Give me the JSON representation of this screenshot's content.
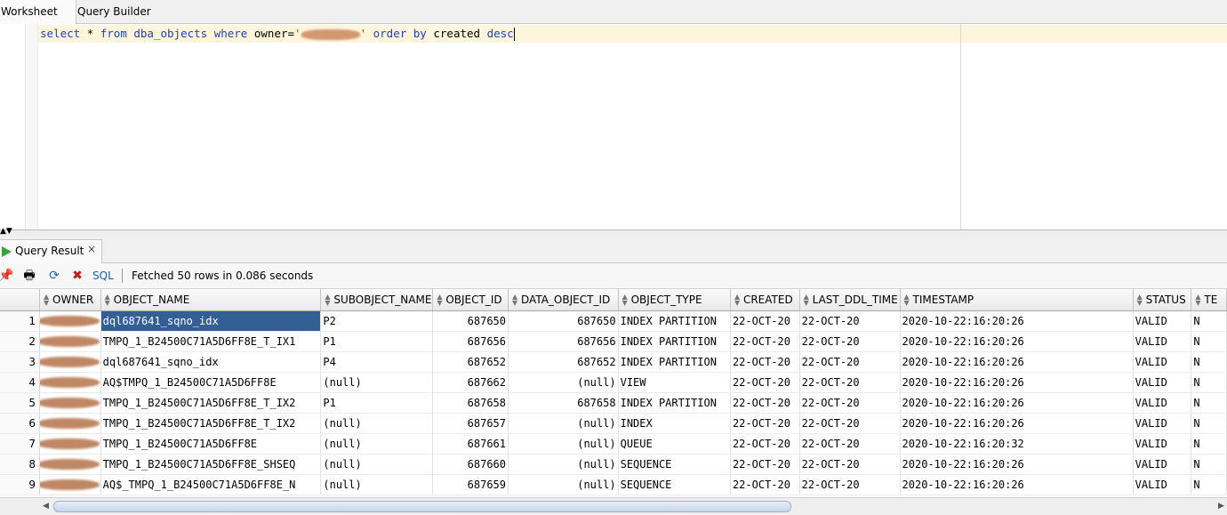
{
  "tabs": [
    {
      "label": "Worksheet"
    },
    {
      "label": "Query Builder"
    }
  ],
  "editor": {
    "tokens": [
      "select",
      "*",
      "from dba_objects",
      "where",
      "owner=",
      "'",
      "'",
      "order by",
      "created",
      "desc"
    ]
  },
  "result_tab": {
    "label": "Query Result",
    "close": "×"
  },
  "toolbar": {
    "sql_label": "SQL",
    "status": "Fetched 50 rows in 0.086 seconds"
  },
  "grid": {
    "columns": [
      "OWNER",
      "OBJECT_NAME",
      "SUBOBJECT_NAME",
      "OBJECT_ID",
      "DATA_OBJECT_ID",
      "OBJECT_TYPE",
      "CREATED",
      "LAST_DDL_TIME",
      "TIMESTAMP",
      "STATUS",
      "TE"
    ],
    "rows": [
      {
        "n": "1",
        "object_name": "dql687641_sqno_idx",
        "subobject_name": "P2",
        "object_id": "687650",
        "data_object_id": "687650",
        "object_type": "INDEX PARTITION",
        "created": "22-OCT-20",
        "last_ddl_time": "22-OCT-20",
        "timestamp": "2020-10-22:16:20:26",
        "status": "VALID",
        "te": "N"
      },
      {
        "n": "2",
        "object_name": "TMPQ_1_B24500C71A5D6FF8E_T_IX1",
        "subobject_name": "P1",
        "object_id": "687656",
        "data_object_id": "687656",
        "object_type": "INDEX PARTITION",
        "created": "22-OCT-20",
        "last_ddl_time": "22-OCT-20",
        "timestamp": "2020-10-22:16:20:26",
        "status": "VALID",
        "te": "N"
      },
      {
        "n": "3",
        "object_name": "dql687641_sqno_idx",
        "subobject_name": "P4",
        "object_id": "687652",
        "data_object_id": "687652",
        "object_type": "INDEX PARTITION",
        "created": "22-OCT-20",
        "last_ddl_time": "22-OCT-20",
        "timestamp": "2020-10-22:16:20:26",
        "status": "VALID",
        "te": "N"
      },
      {
        "n": "4",
        "object_name": "AQ$TMPQ_1_B24500C71A5D6FF8E",
        "subobject_name": "(null)",
        "object_id": "687662",
        "data_object_id": "(null)",
        "object_type": "VIEW",
        "created": "22-OCT-20",
        "last_ddl_time": "22-OCT-20",
        "timestamp": "2020-10-22:16:20:26",
        "status": "VALID",
        "te": "N"
      },
      {
        "n": "5",
        "object_name": "TMPQ_1_B24500C71A5D6FF8E_T_IX2",
        "subobject_name": "P1",
        "object_id": "687658",
        "data_object_id": "687658",
        "object_type": "INDEX PARTITION",
        "created": "22-OCT-20",
        "last_ddl_time": "22-OCT-20",
        "timestamp": "2020-10-22:16:20:26",
        "status": "VALID",
        "te": "N"
      },
      {
        "n": "6",
        "object_name": "TMPQ_1_B24500C71A5D6FF8E_T_IX2",
        "subobject_name": "(null)",
        "object_id": "687657",
        "data_object_id": "(null)",
        "object_type": "INDEX",
        "created": "22-OCT-20",
        "last_ddl_time": "22-OCT-20",
        "timestamp": "2020-10-22:16:20:26",
        "status": "VALID",
        "te": "N"
      },
      {
        "n": "7",
        "object_name": "TMPQ_1_B24500C71A5D6FF8E",
        "subobject_name": "(null)",
        "object_id": "687661",
        "data_object_id": "(null)",
        "object_type": "QUEUE",
        "created": "22-OCT-20",
        "last_ddl_time": "22-OCT-20",
        "timestamp": "2020-10-22:16:20:32",
        "status": "VALID",
        "te": "N"
      },
      {
        "n": "8",
        "object_name": "TMPQ_1_B24500C71A5D6FF8E_SHSEQ",
        "subobject_name": "(null)",
        "object_id": "687660",
        "data_object_id": "(null)",
        "object_type": "SEQUENCE",
        "created": "22-OCT-20",
        "last_ddl_time": "22-OCT-20",
        "timestamp": "2020-10-22:16:20:26",
        "status": "VALID",
        "te": "N"
      },
      {
        "n": "9",
        "object_name": "AQ$_TMPQ_1_B24500C71A5D6FF8E_N",
        "subobject_name": "(null)",
        "object_id": "687659",
        "data_object_id": "(null)",
        "object_type": "SEQUENCE",
        "created": "22-OCT-20",
        "last_ddl_time": "22-OCT-20",
        "timestamp": "2020-10-22:16:20:26",
        "status": "VALID",
        "te": "N"
      }
    ]
  }
}
